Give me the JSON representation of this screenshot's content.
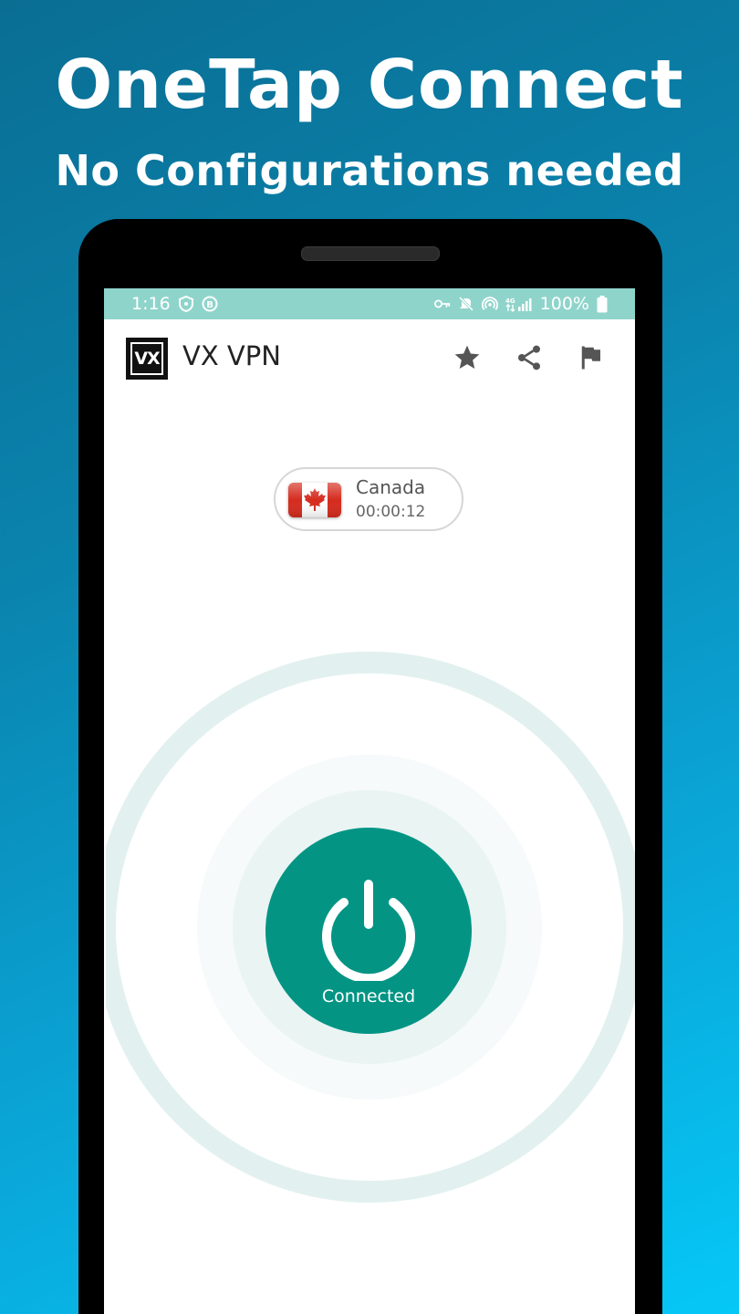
{
  "promo": {
    "headline": "OneTap Connect",
    "subheadline": "No Configurations needed"
  },
  "status_bar": {
    "time": "1:16",
    "left_icons": [
      "shield-icon",
      "b-badge-icon"
    ],
    "right_icons": [
      "vpn-key-icon",
      "mute-icon",
      "hotspot-icon",
      "signal-4g-icon"
    ],
    "network": "4G",
    "battery": "100%"
  },
  "app_bar": {
    "logo_text": "VX",
    "title": "VX VPN",
    "actions": [
      "star-icon",
      "share-icon",
      "flag-icon"
    ]
  },
  "location": {
    "country": "Canada",
    "timer": "00:00:12",
    "flag": "canada-flag-icon"
  },
  "connect": {
    "label": "Connected",
    "icon": "power-icon"
  },
  "colors": {
    "accent": "#039484",
    "status_bar": "#8fd4cb",
    "ring": "#e2f1ef",
    "flag_red": "#d52b1e"
  }
}
